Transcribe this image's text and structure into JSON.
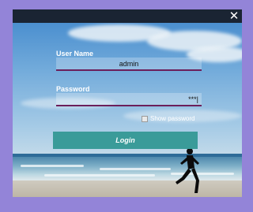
{
  "window": {
    "close_glyph": "✕"
  },
  "form": {
    "username_label": "User Name",
    "username_value": "admin",
    "password_label": "Password",
    "password_value": "***|",
    "show_password_label": "Show password",
    "show_password_checked": false,
    "login_label": "Login"
  },
  "colors": {
    "background": "#9384d8",
    "title_bar": "#1a2433",
    "login_button": "#3a9b99",
    "input_underline": "#6b1f5a"
  }
}
